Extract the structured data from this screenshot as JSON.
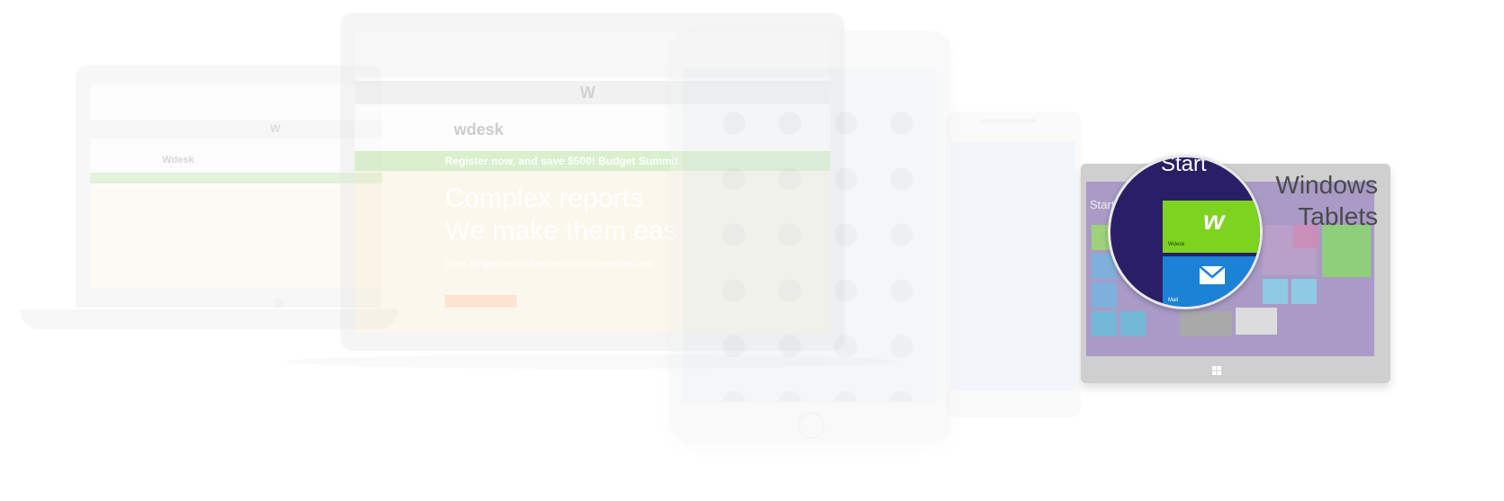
{
  "callout": {
    "line1": "Windows",
    "line2": "Tablets"
  },
  "magnifier": {
    "start_label": "Start",
    "wdesk_tile_label": "Wdesk",
    "mail_tile_label": "Mail",
    "wdesk_logo_text": "w"
  },
  "surface": {
    "start_label": "Start"
  },
  "desktop_site": {
    "brand": "wdesk",
    "banner_text": "Register now, and save $500! Budget Summit",
    "hero_line1": "Complex reports",
    "hero_line2": "We make them eas",
    "hero_sub": "Over 60 percent of Fortune 500 companies use",
    "header_logo": "W"
  },
  "laptop_site": {
    "brand": "Wdesk",
    "header_logo": "W"
  },
  "colors": {
    "windows_dark_blue": "#2a1f66",
    "wdesk_green": "#7ed321",
    "mail_blue": "#1b82d6",
    "surface_bezel": "#c8c8c8",
    "surface_screen": "#6f5aa6",
    "callout_text": "#4a4a4a",
    "site_green": "#6dbb4a",
    "site_orange": "#f08a24"
  }
}
